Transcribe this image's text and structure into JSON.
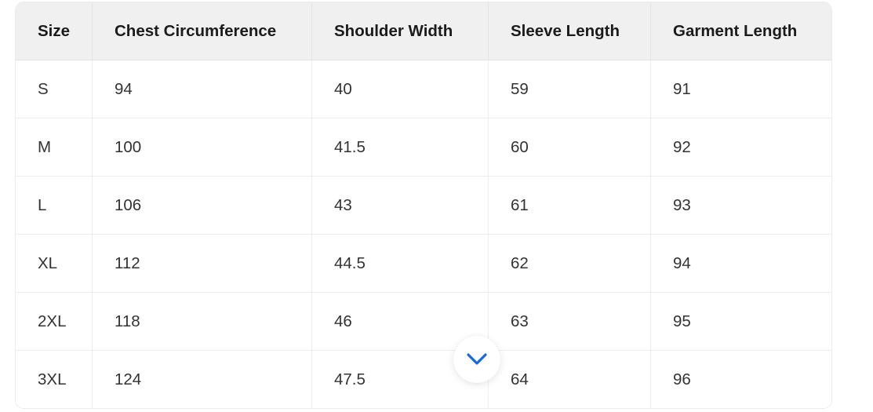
{
  "table": {
    "name": "size-chart",
    "headers": [
      "Size",
      "Chest Circumference",
      "Shoulder Width",
      "Sleeve Length",
      "Garment Length"
    ],
    "rows": [
      {
        "size": "S",
        "chest": "94",
        "shoulder": "40",
        "sleeve": "59",
        "garment": "91"
      },
      {
        "size": "M",
        "chest": "100",
        "shoulder": "41.5",
        "sleeve": "60",
        "garment": "92"
      },
      {
        "size": "L",
        "chest": "106",
        "shoulder": "43",
        "sleeve": "61",
        "garment": "93"
      },
      {
        "size": "XL",
        "chest": "112",
        "shoulder": "44.5",
        "sleeve": "62",
        "garment": "94"
      },
      {
        "size": "2XL",
        "chest": "118",
        "shoulder": "46",
        "sleeve": "63",
        "garment": "95"
      },
      {
        "size": "3XL",
        "chest": "124",
        "shoulder": "47.5",
        "sleeve": "64",
        "garment": "96"
      }
    ]
  },
  "expand_control": {
    "icon": "chevron-down-icon",
    "label": "",
    "accent_color": "#1668e3"
  },
  "colors": {
    "header_background": "#f0f0f0",
    "header_text": "#1b1b1b",
    "cell_background": "#ffffff",
    "cell_text": "#333333",
    "border": "#ededed",
    "accent": "#1668e3"
  }
}
